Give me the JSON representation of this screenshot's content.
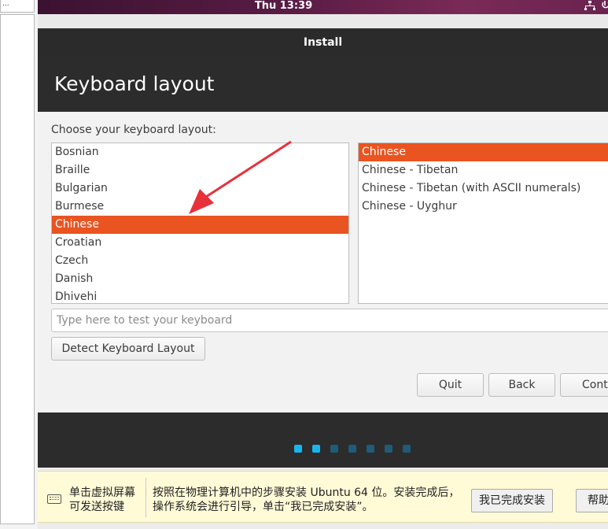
{
  "host": {
    "left_top_text": "..."
  },
  "topbar": {
    "clock": "Thu 13:39",
    "network_icon": "network-icon",
    "power_icon": "power-icon"
  },
  "window": {
    "title": "Install",
    "heading": "Keyboard layout"
  },
  "keyboard": {
    "prompt": "Choose your keyboard layout:",
    "layouts": [
      "Bosnian",
      "Braille",
      "Bulgarian",
      "Burmese",
      "Chinese",
      "Croatian",
      "Czech",
      "Danish",
      "Dhivehi"
    ],
    "selected_layout": "Chinese",
    "variants": [
      "Chinese",
      "Chinese - Tibetan",
      "Chinese - Tibetan (with ASCII numerals)",
      "Chinese - Uyghur"
    ],
    "selected_variant": "Chinese",
    "test_placeholder": "Type here to test your keyboard",
    "detect_label": "Detect Keyboard Layout"
  },
  "nav": {
    "quit": "Quit",
    "back": "Back",
    "continue": "Cont"
  },
  "progress": {
    "total_steps": 7,
    "completed_steps": 2,
    "active_color": "#19b6ee",
    "inactive_color": "#1e5c79"
  },
  "accent_color": "#e95420",
  "notification": {
    "message1": "单击虚拟屏幕可发送按键",
    "message2": "按照在物理计算机中的步骤安装 Ubuntu 64 位。安装完成后，操作系统会进行引导，单击“我已完成安装”。",
    "done_button": "我已完成安装",
    "help_button": "帮助"
  }
}
